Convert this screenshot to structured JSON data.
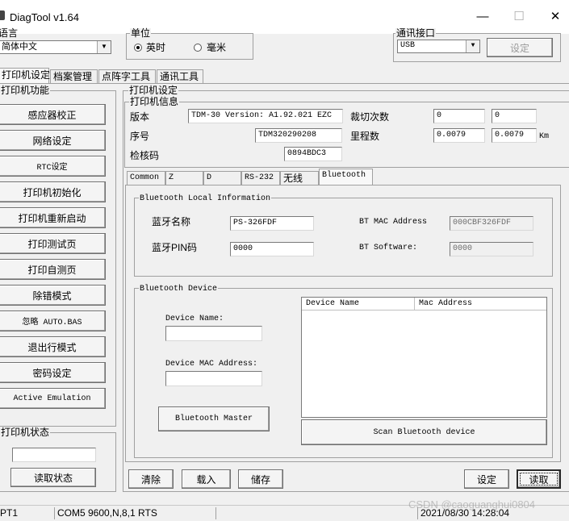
{
  "window": {
    "title": "DiagTool v1.64",
    "min": "—",
    "max": "☐",
    "close": "✕"
  },
  "language": {
    "label": "语言",
    "value": "简体中文"
  },
  "unit": {
    "label": "单位",
    "inch": "英时",
    "mm": "毫米",
    "selected": "inch"
  },
  "comm": {
    "label": "通讯接口",
    "value": "USB",
    "set_button": "设定"
  },
  "main_tabs": [
    "打印机设定",
    "档案管理",
    "点阵字工具",
    "通讯工具"
  ],
  "functions": {
    "title": "打印机功能",
    "buttons": [
      "感应器校正",
      "网络设定",
      "RTC设定",
      "打印机初始化",
      "打印机重新启动",
      "打印测试页",
      "打印自测页",
      "除错模式",
      "忽略 AUTO.BAS",
      "退出行模式",
      "密码设定",
      "Active Emulation"
    ]
  },
  "status": {
    "title": "打印机状态",
    "value": "",
    "read_button": "读取状态"
  },
  "settings": {
    "title": "打印机设定",
    "info_title": "打印机信息"
  },
  "info": {
    "version_label": "版本",
    "version_value": "TDM-30 Version: A1.92.021 EZC",
    "serial_label": "序号",
    "serial_value": "TDM320290208",
    "checksum_label": "检核码",
    "checksum_value": "0894BDC3",
    "cut_label": "裁切次数",
    "cut_value1": "0",
    "cut_value2": "0",
    "mileage_label": "里程数",
    "mileage_value1": "0.0079",
    "mileage_value2": "0.0079",
    "mileage_unit": "Km"
  },
  "sub_tabs": [
    "Common",
    "Z",
    "D",
    "RS-232",
    "无线",
    "Bluetooth"
  ],
  "bt_local": {
    "title": "Bluetooth Local Information",
    "name_label": "蓝牙名称",
    "name_value": "PS-326FDF",
    "pin_label": "蓝牙PIN码",
    "pin_value": "0000",
    "mac_label": "BT MAC Address",
    "mac_value": "000CBF326FDF",
    "sw_label": "BT Software:",
    "sw_value": "0000"
  },
  "bt_device": {
    "title": "Bluetooth Device",
    "device_name_label": "Device Name:",
    "device_name_value": "",
    "device_mac_label": "Device MAC Address:",
    "device_mac_value": "",
    "master_button": "Bluetooth Master",
    "col_name": "Device Name",
    "col_mac": "Mac Address",
    "scan_button": "Scan Bluetooth device"
  },
  "bottom_buttons": {
    "clear": "清除",
    "load": "载入",
    "save": "储存",
    "set": "设定",
    "read": "读取"
  },
  "statusbar": {
    "port": "PT1",
    "comm": "COM5 9600,N,8,1 RTS",
    "datetime": "2021/08/30 14:28:04",
    "watermark": "CSDN @caoguanghui0804"
  }
}
